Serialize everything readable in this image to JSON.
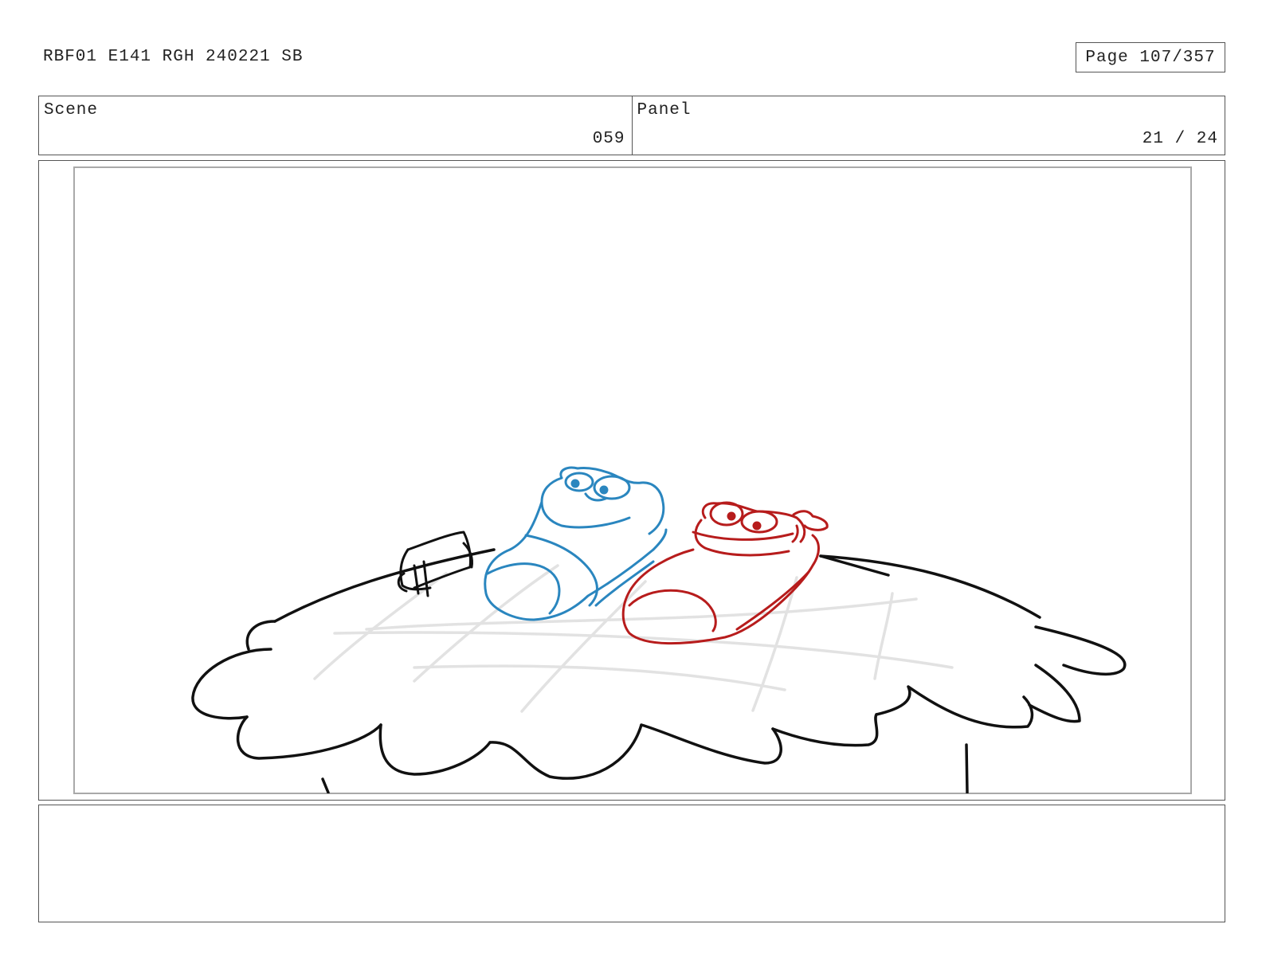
{
  "header": {
    "title": "RBF01 E141 RGH 240221 SB",
    "page": "Page 107/357"
  },
  "scene": {
    "label": "Scene",
    "value": "059"
  },
  "panel": {
    "label": "Panel",
    "value": "21 / 24"
  },
  "notes": {
    "text": ""
  },
  "artwork": {
    "line_color": "#111111",
    "blanket_grid_color": "#e2e2e2",
    "blue_character_color": "#2a86bf",
    "red_character_color": "#b71c1c"
  }
}
